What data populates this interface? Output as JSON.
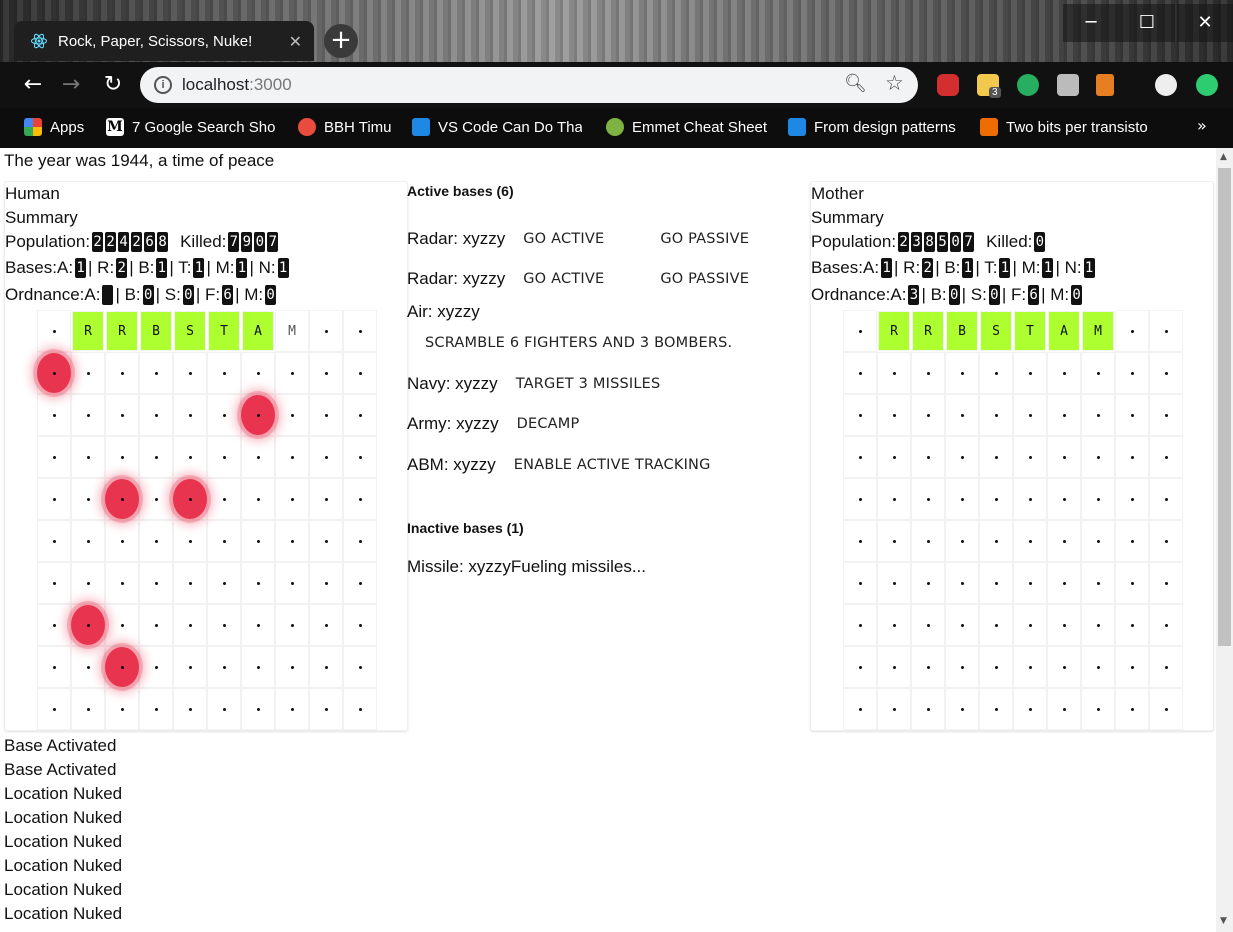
{
  "browser": {
    "tab_title": "Rock, Paper, Scissors, Nuke!",
    "url_host": "localhost",
    "url_port": ":3000",
    "extension_badge": "3",
    "bookmarks": [
      {
        "label": "Apps",
        "color": "#e74c3c"
      },
      {
        "label": "7 Google Search Sho",
        "color": "#ffffff"
      },
      {
        "label": "BBH Timu",
        "color": "#e74c3c"
      },
      {
        "label": "VS Code Can Do Tha",
        "color": "#1e88e5"
      },
      {
        "label": "Emmet Cheat Sheet",
        "color": "#7cb342"
      },
      {
        "label": "From design patterns",
        "color": "#1e88e5"
      },
      {
        "label": "Two bits per transisto",
        "color": "#ef6c00"
      }
    ],
    "more_label": "»"
  },
  "intro": "The year was 1944, a time of peace",
  "players": [
    {
      "name": "Human",
      "summary": "Summary",
      "population_label": "Population:",
      "population": [
        "2",
        "2",
        "4",
        "2",
        "6",
        "8"
      ],
      "killed_label": "Killed:",
      "killed": [
        "7",
        "9",
        "0",
        "7"
      ],
      "bases_label": "Bases:",
      "bases": [
        [
          "A",
          "1"
        ],
        [
          "R",
          "2"
        ],
        [
          "B",
          "1"
        ],
        [
          "T",
          "1"
        ],
        [
          "M",
          "1"
        ],
        [
          "N",
          "1"
        ]
      ],
      "ordnance_label": "Ordnance:",
      "ordnance": [
        [
          "A",
          ""
        ],
        [
          "B",
          "0"
        ],
        [
          "S",
          "0"
        ],
        [
          "F",
          "6"
        ],
        [
          "M",
          "0"
        ]
      ],
      "top_row": [
        "•",
        "R",
        "R",
        "B",
        "S",
        "T",
        "A",
        "M",
        "•",
        "•"
      ],
      "top_row_base": [
        false,
        true,
        true,
        true,
        true,
        true,
        true,
        false,
        false,
        false
      ],
      "nukes": [
        [
          1,
          0
        ],
        [
          2,
          6
        ],
        [
          4,
          2
        ],
        [
          4,
          4
        ],
        [
          7,
          1
        ],
        [
          8,
          2
        ]
      ]
    },
    {
      "name": "Mother",
      "summary": "Summary",
      "population_label": "Population:",
      "population": [
        "2",
        "3",
        "8",
        "5",
        "0",
        "7"
      ],
      "killed_label": "Killed:",
      "killed": [
        "0"
      ],
      "bases_label": "Bases:",
      "bases": [
        [
          "A",
          "1"
        ],
        [
          "R",
          "2"
        ],
        [
          "B",
          "1"
        ],
        [
          "T",
          "1"
        ],
        [
          "M",
          "1"
        ],
        [
          "N",
          "1"
        ]
      ],
      "ordnance_label": "Ordnance:",
      "ordnance": [
        [
          "A",
          "3"
        ],
        [
          "B",
          "0"
        ],
        [
          "S",
          "0"
        ],
        [
          "F",
          "6"
        ],
        [
          "M",
          "0"
        ]
      ],
      "top_row": [
        "•",
        "R",
        "R",
        "B",
        "S",
        "T",
        "A",
        "M",
        "•",
        "•"
      ],
      "top_row_base": [
        false,
        true,
        true,
        true,
        true,
        true,
        true,
        true,
        false,
        false
      ],
      "nukes": []
    }
  ],
  "center": {
    "active_title": "Active bases (6)",
    "active": [
      {
        "label": "Radar: xyzzy",
        "buttons": [
          "GO ACTIVE",
          "GO PASSIVE"
        ]
      },
      {
        "label": "Radar: xyzzy",
        "buttons": [
          "GO ACTIVE",
          "GO PASSIVE"
        ]
      },
      {
        "label": "Air: xyzzy",
        "buttons": []
      },
      {
        "label": "",
        "buttons": [
          "SCRAMBLE 6 FIGHTERS AND 3 BOMBERS."
        ]
      },
      {
        "label": "Navy: xyzzy",
        "buttons": [
          "TARGET 3 MISSILES"
        ]
      },
      {
        "label": "Army: xyzzy",
        "buttons": [
          "DECAMP"
        ]
      },
      {
        "label": "ABM: xyzzy",
        "buttons": [
          "ENABLE ACTIVE TRACKING"
        ]
      }
    ],
    "inactive_title": "Inactive bases (1)",
    "inactive": [
      {
        "label": "Missile: xyzzyFueling missiles..."
      }
    ]
  },
  "log": [
    "Base Activated",
    "Base Activated",
    "Location Nuked",
    "Location Nuked",
    "Location Nuked",
    "Location Nuked",
    "Location Nuked",
    "Location Nuked"
  ]
}
